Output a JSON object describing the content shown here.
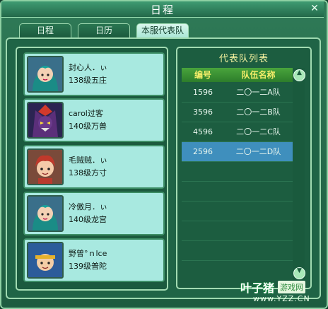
{
  "window": {
    "title": "日程",
    "close_icon": "close-icon"
  },
  "tabs": [
    {
      "label": "日程",
      "active": false
    },
    {
      "label": "日历",
      "active": false
    },
    {
      "label": "本服代表队",
      "active": true
    }
  ],
  "members": [
    {
      "name": "封心人．ぃ",
      "detail": "138级五庄",
      "avatar": "avatar-teal-hair-girl"
    },
    {
      "name": "carol过客",
      "detail": "140级万兽",
      "avatar": "avatar-purple-demon"
    },
    {
      "name": "毛贼贼．ぃ",
      "detail": "138级方寸",
      "avatar": "avatar-red-hair-boy"
    },
    {
      "name": "冷傲月．ぃ",
      "detail": "140级龙宫",
      "avatar": "avatar-teal-hair-girl"
    },
    {
      "name": "野曽°ｎlce",
      "detail": "139级普陀",
      "avatar": "avatar-blue-headband-boy"
    }
  ],
  "team_list": {
    "title": "代表队列表",
    "columns": [
      "编号",
      "队伍名称"
    ],
    "rows": [
      {
        "id": "1596",
        "name": "二〇一二A队",
        "selected": false
      },
      {
        "id": "3596",
        "name": "二〇一二B队",
        "selected": false
      },
      {
        "id": "4596",
        "name": "二〇一二C队",
        "selected": false
      },
      {
        "id": "2596",
        "name": "二〇一二D队",
        "selected": true
      }
    ]
  },
  "scrollbar": {
    "up_icon": "scroll-up-icon",
    "down_icon": "scroll-down-icon"
  },
  "watermark": {
    "brand": "叶子猪",
    "tag": "游戏网",
    "url": "www.YZZ.CN"
  }
}
